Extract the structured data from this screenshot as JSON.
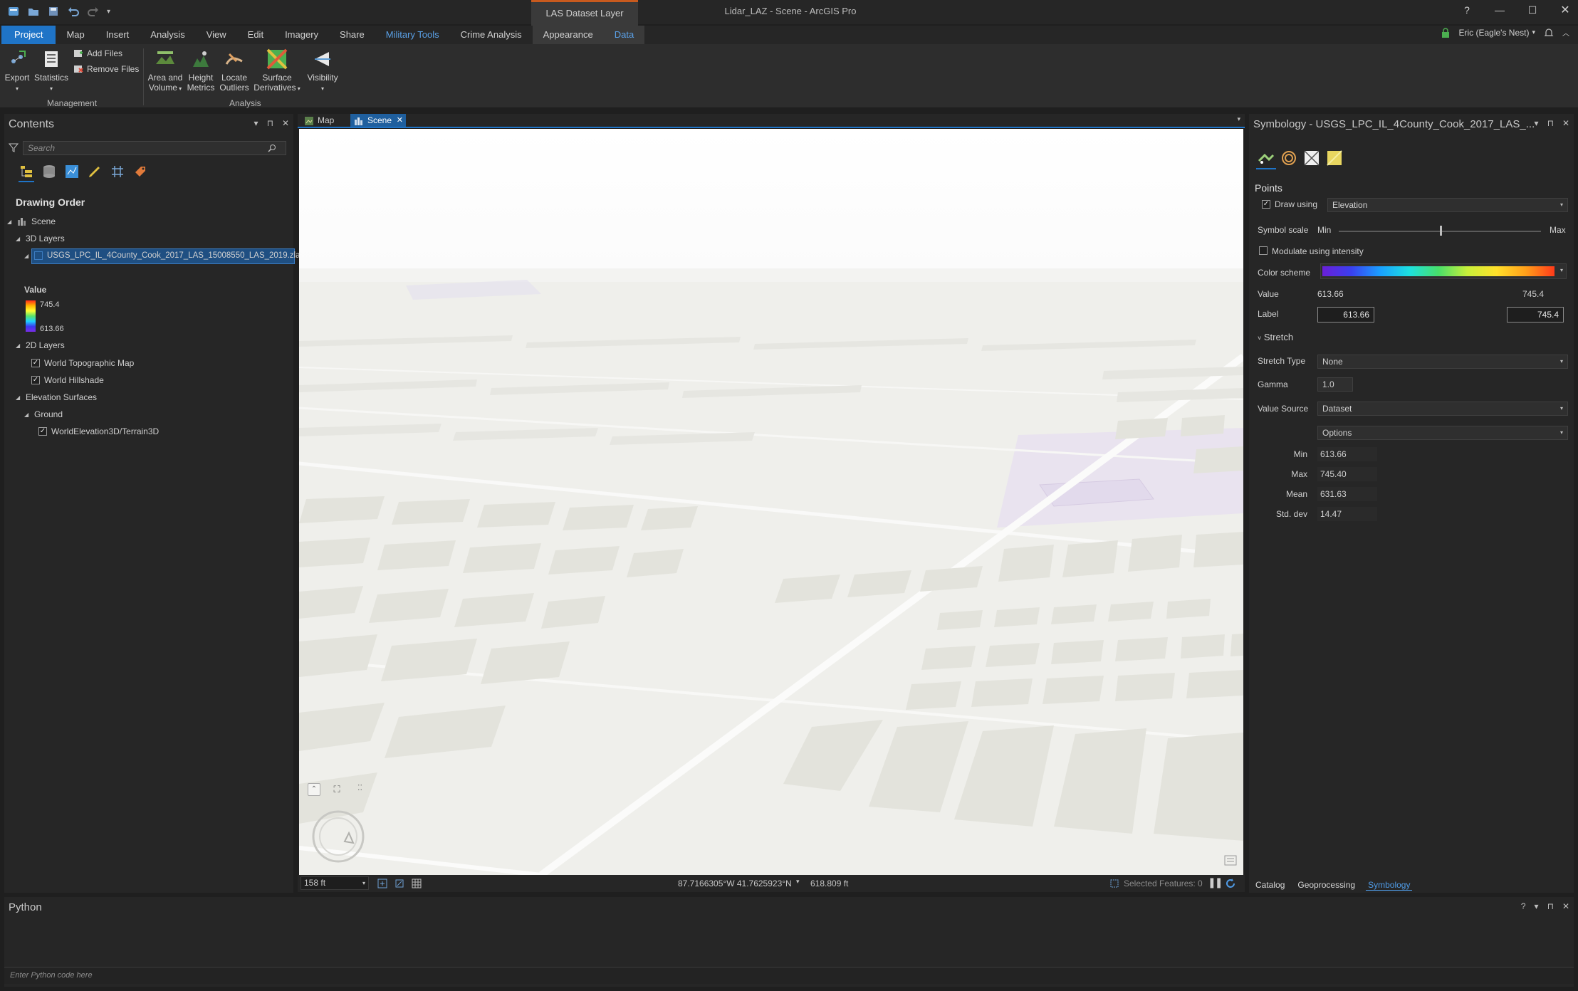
{
  "titlebar": {
    "context_group": "LAS Dataset Layer",
    "window_title": "Lidar_LAZ - Scene - ArcGIS Pro",
    "help": "?",
    "minimize": "—",
    "maximize": "☐",
    "close": "✕"
  },
  "ribbon_tabs": [
    "Project",
    "Map",
    "Insert",
    "Analysis",
    "View",
    "Edit",
    "Imagery",
    "Share",
    "Military Tools",
    "Crime Analysis",
    "Appearance",
    "Data"
  ],
  "user": {
    "name": "Eric (Eagle's Nest)",
    "dropdown": "▾"
  },
  "ribbon": {
    "export": "Export",
    "statistics": "Statistics",
    "add_files": "Add Files",
    "remove_files": "Remove Files",
    "management_group": "Management",
    "area_volume_1": "Area and",
    "area_volume_2": "Volume",
    "height_metrics_1": "Height",
    "height_metrics_2": "Metrics",
    "locate_outliers_1": "Locate",
    "locate_outliers_2": "Outliers",
    "surface_derivatives_1": "Surface",
    "surface_derivatives_2": "Derivatives",
    "visibility": "Visibility",
    "analysis_group": "Analysis"
  },
  "contents": {
    "title": "Contents",
    "search_placeholder": "Search",
    "drawing_order": "Drawing Order",
    "scene": "Scene",
    "layers_3d": "3D Layers",
    "las_layer": "USGS_LPC_IL_4County_Cook_2017_LAS_15008550_LAS_2019.zlas",
    "value_label": "Value",
    "value_max": "745.4",
    "value_min": "613.66",
    "layers_2d": "2D Layers",
    "world_topo": "World Topographic Map",
    "world_hillshade": "World Hillshade",
    "elevation_surfaces": "Elevation Surfaces",
    "ground": "Ground",
    "terrain": "WorldElevation3D/Terrain3D"
  },
  "views": {
    "map_tab": "Map",
    "scene_tab": "Scene"
  },
  "status": {
    "scale": "158 ft",
    "coords": "87.7166305°W 41.7625923°N",
    "elevation": "618.809 ft",
    "selected": "Selected Features: 0"
  },
  "symbology": {
    "title": "Symbology - USGS_LPC_IL_4County_Cook_2017_LAS_...",
    "points": "Points",
    "draw_using": "Draw using",
    "draw_using_value": "Elevation",
    "symbol_scale": "Symbol scale",
    "min": "Min",
    "max": "Max",
    "modulate": "Modulate using intensity",
    "color_scheme": "Color scheme",
    "value": "Value",
    "value_min": "613.66",
    "value_max": "745.4",
    "label": "Label",
    "label_min": "613.66",
    "label_max": "745.4",
    "stretch": "Stretch",
    "stretch_type": "Stretch Type",
    "stretch_type_value": "None",
    "gamma": "Gamma",
    "gamma_value": "1.0",
    "value_source": "Value Source",
    "value_source_value": "Dataset",
    "options": "Options",
    "stat_min_lbl": "Min",
    "stat_min": "613.66",
    "stat_max_lbl": "Max",
    "stat_max": "745.40",
    "stat_mean_lbl": "Mean",
    "stat_mean": "631.63",
    "stat_std_lbl": "Std. dev",
    "stat_std": "14.47"
  },
  "bottom_tabs": {
    "catalog": "Catalog",
    "geoprocessing": "Geoprocessing",
    "symbology": "Symbology"
  },
  "python": {
    "title": "Python",
    "placeholder": "Enter Python code here"
  },
  "colors": {
    "accent": "#1f74c7",
    "context_orange": "#c85a1e",
    "bg": "#1f1f1f"
  }
}
